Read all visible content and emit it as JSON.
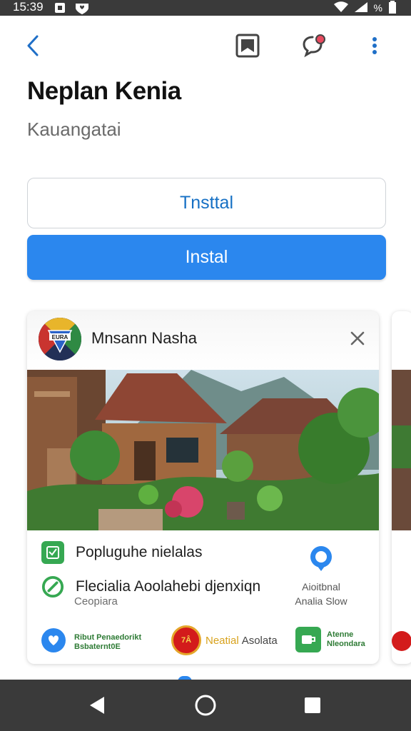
{
  "status_bar": {
    "time": "15:39",
    "battery_text": "%"
  },
  "app_bar": {
    "icons": [
      "back-arrow-icon",
      "bookmark-icon",
      "chat-bubble-notification-icon",
      "more-vert-icon"
    ]
  },
  "app": {
    "title": "Neplan Kenia",
    "subtitle": "Kauangatai"
  },
  "buttons": {
    "outline_label": "Tnsttal",
    "filled_label": "Instal"
  },
  "card": {
    "avatar_text": "EURA",
    "name": "Mnsann Nasha",
    "feature1": "Popluguhe nielalas",
    "feature2": "Flecialia Aoolahebi djenxiqn",
    "feature2_sub": "Ceopiara",
    "side_label_1": "Aioitbnal",
    "side_label_2": "Analia Slow",
    "brands": [
      {
        "line1": "Ribut Penaedorikt",
        "line2": "Bsbaternt0E"
      },
      {
        "badge": "7Â",
        "text_a": "Neatial",
        "text_b": "Asolata"
      },
      {
        "line1": "Atenne",
        "line2": "Nleondara"
      }
    ]
  },
  "colors": {
    "accent": "#2b87ee",
    "link": "#1670c4",
    "status_bar_bg": "#3a3a3a",
    "green": "#36a852",
    "brand_red": "#d31b1b"
  }
}
